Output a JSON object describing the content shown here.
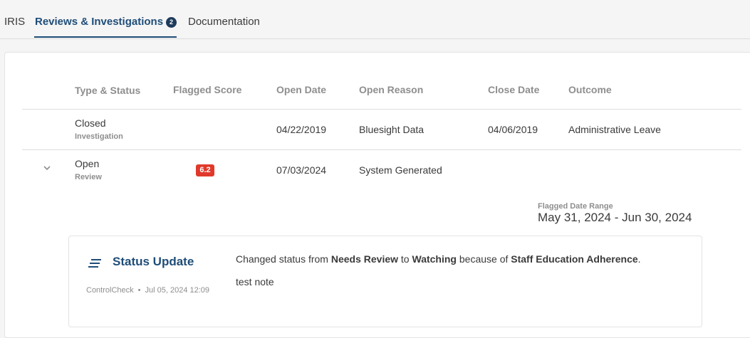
{
  "tabs": [
    {
      "label": "IRIS"
    },
    {
      "label": "Reviews & Investigations",
      "badge": "2"
    },
    {
      "label": "Documentation"
    }
  ],
  "table": {
    "headers": [
      "Type & Status",
      "Flagged Score",
      "Open Date",
      "Open Reason",
      "Close Date",
      "Outcome"
    ],
    "rows": [
      {
        "status": "Closed",
        "type": "Investigation",
        "flagged_score": "",
        "open_date": "04/22/2019",
        "open_reason": "Bluesight Data",
        "close_date": "04/06/2019",
        "outcome": "Administrative Leave"
      },
      {
        "status": "Open",
        "type": "Review",
        "flagged_score": "6.2",
        "open_date": "07/03/2024",
        "open_reason": "System Generated",
        "close_date": "",
        "outcome": ""
      }
    ]
  },
  "flagged_range": {
    "label": "Flagged Date Range",
    "value": "May 31, 2024 - Jun 30, 2024"
  },
  "status_update": {
    "title": "Status Update",
    "author": "ControlCheck",
    "separator": "•",
    "timestamp": "Jul 05, 2024 12:09",
    "text_prefix": "Changed status from ",
    "from_status": "Needs Review",
    "text_mid": " to ",
    "to_status": "Watching",
    "text_because": " because of ",
    "reason": "Staff Education Adherence",
    "text_end": ".",
    "note": "test note"
  },
  "colors": {
    "accent": "#1f4d78",
    "badge_red": "#e0392b",
    "muted": "#8e8e8e"
  }
}
